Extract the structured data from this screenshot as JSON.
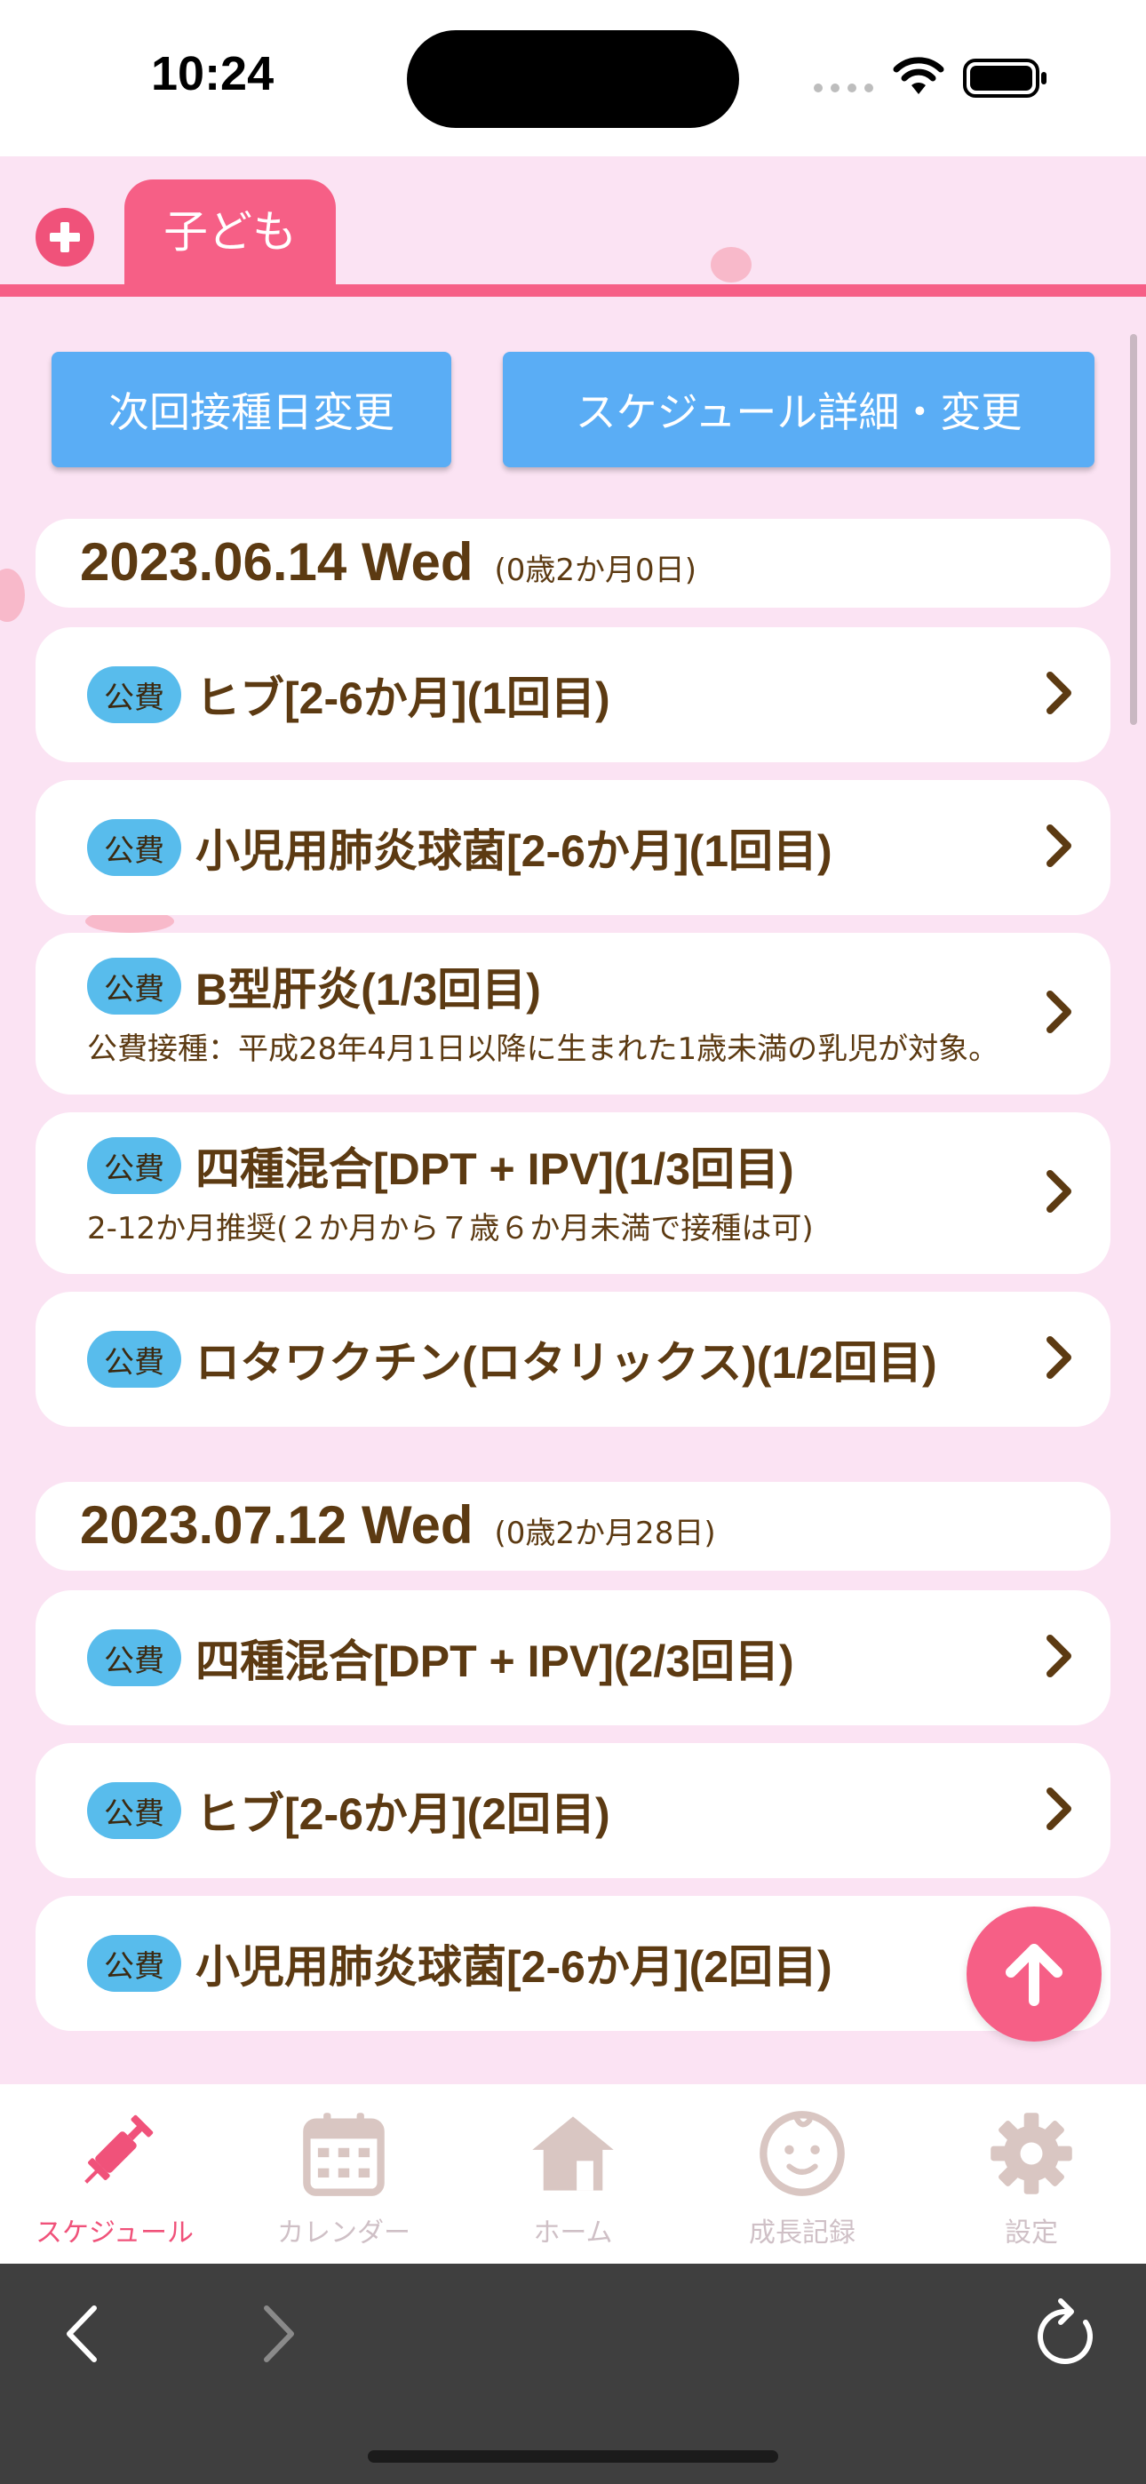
{
  "status_bar": {
    "time": "10:24"
  },
  "child_tabs": {
    "add_icon": "plus-circle-icon",
    "active_child": "子ども"
  },
  "actions": {
    "next_date_button": "次回接種日変更",
    "schedule_button": "スケジュール詳細・変更"
  },
  "groups": [
    {
      "date": "2023.06.14 Wed",
      "age": "(0歳2か月0日)",
      "items": [
        {
          "badge": "公費",
          "name": "ヒブ[2-6か月](1回目)",
          "note": ""
        },
        {
          "badge": "公費",
          "name": "小児用肺炎球菌[2-6か月](1回目)",
          "note": ""
        },
        {
          "badge": "公費",
          "name": "B型肝炎(1/3回目)",
          "note": "公費接種：平成28年4月1日以降に生まれた1歳未満の乳児が対象。"
        },
        {
          "badge": "公費",
          "name": "四種混合[DPT + IPV](1/3回目)",
          "note": "2-12か月推奨(２か月から７歳６か月未満で接種は可)"
        },
        {
          "badge": "公費",
          "name": "ロタワクチン(ロタリックス)(1/2回目)",
          "note": ""
        }
      ]
    },
    {
      "date": "2023.07.12 Wed",
      "age": "(0歳2か月28日)",
      "items": [
        {
          "badge": "公費",
          "name": "四種混合[DPT + IPV](2/3回目)",
          "note": ""
        },
        {
          "badge": "公費",
          "name": "ヒブ[2-6か月](2回目)",
          "note": ""
        },
        {
          "badge": "公費",
          "name": "小児用肺炎球菌[2-6か月](2回目)",
          "note": ""
        }
      ]
    }
  ],
  "fab": {
    "icon": "arrow-up-icon"
  },
  "bottom_nav": [
    {
      "label": "スケジュール",
      "icon": "syringe-icon",
      "active": true
    },
    {
      "label": "カレンダー",
      "icon": "calendar-icon",
      "active": false
    },
    {
      "label": "ホーム",
      "icon": "home-icon",
      "active": false
    },
    {
      "label": "成長記録",
      "icon": "baby-face-icon",
      "active": false
    },
    {
      "label": "設定",
      "icon": "gear-icon",
      "active": false
    }
  ],
  "colors": {
    "background": "#fbe3f3",
    "accent_pink": "#f65f86",
    "button_blue": "#5aadf5",
    "badge_blue": "#58bcec",
    "text_brown": "#5c3a12"
  }
}
